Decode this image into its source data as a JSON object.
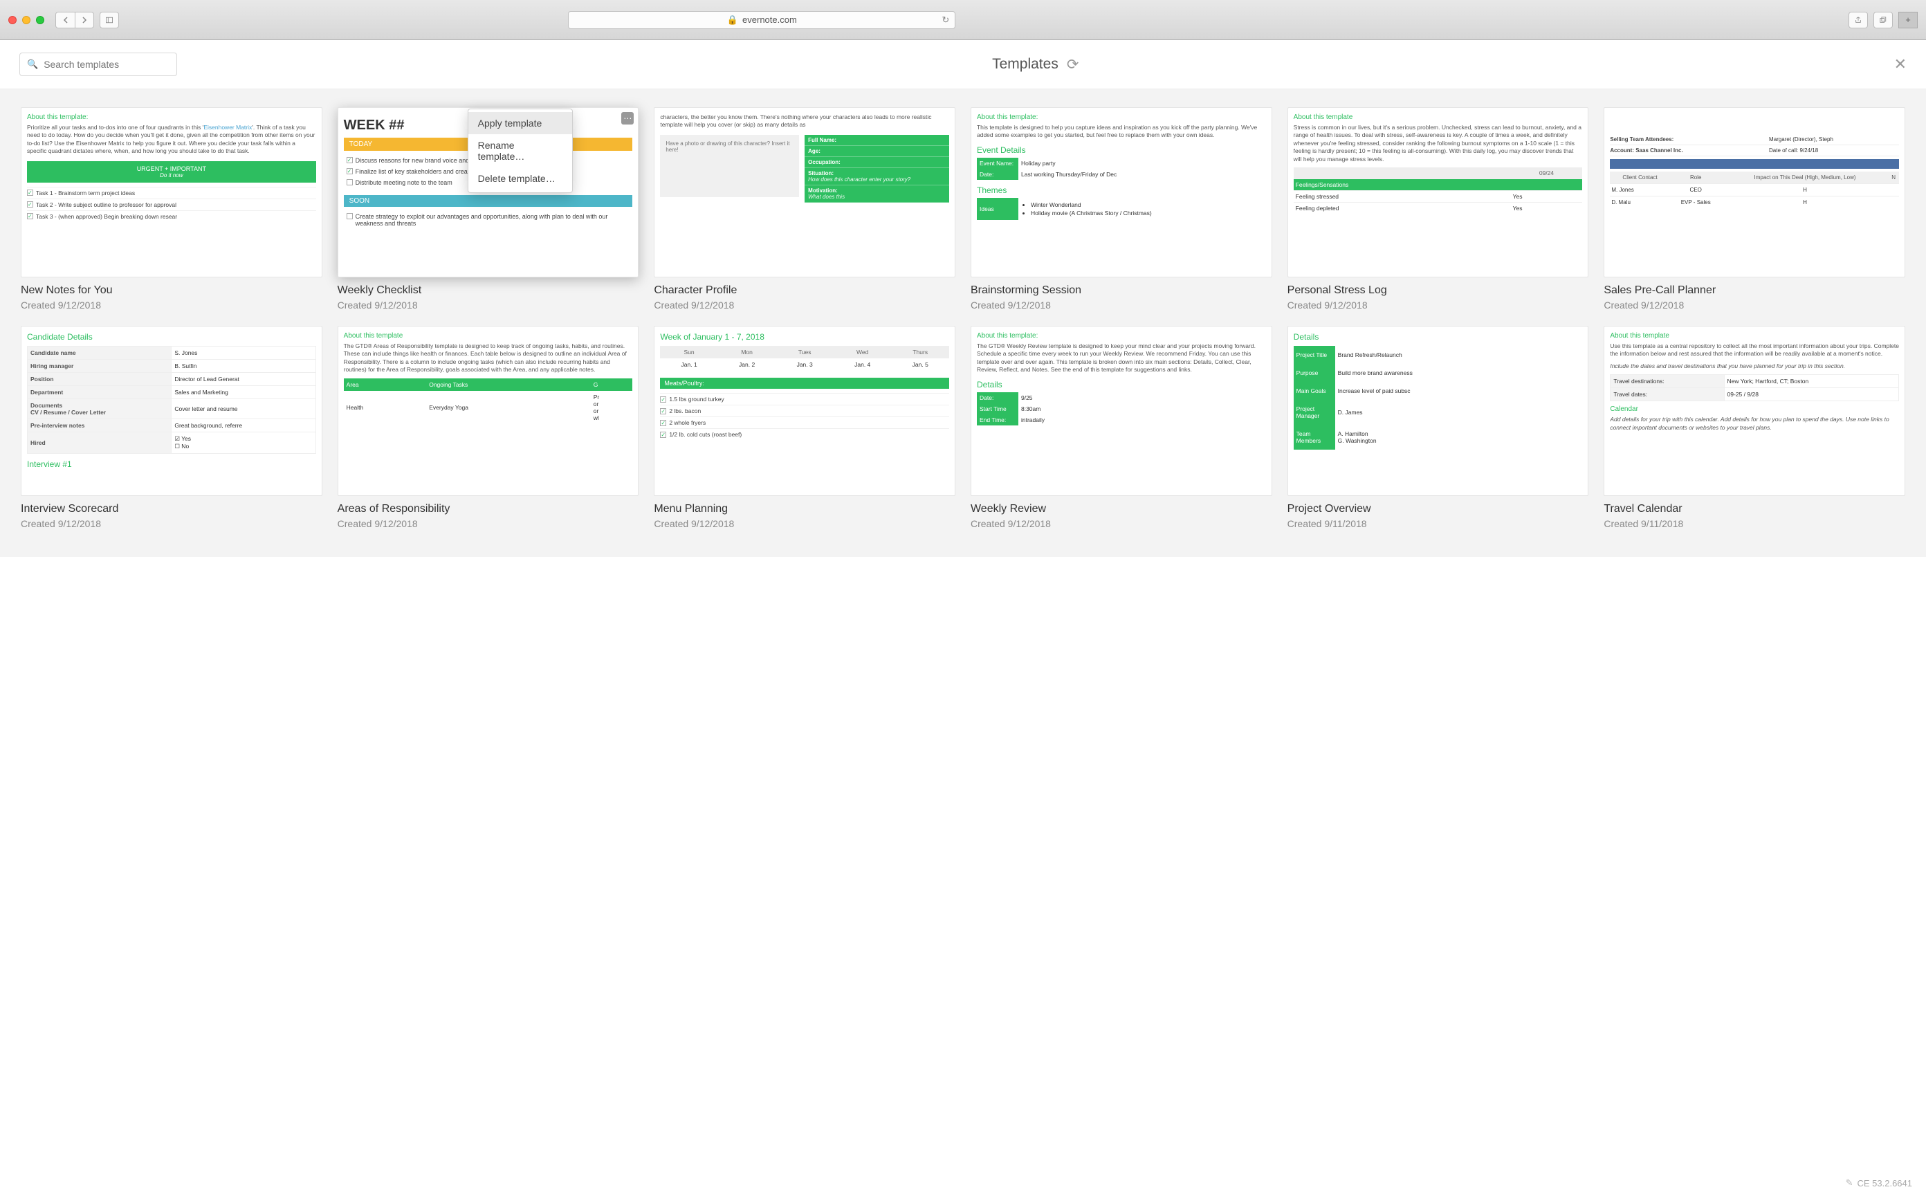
{
  "browser": {
    "url_host": "evernote.com",
    "lock": "🔒"
  },
  "header": {
    "search_placeholder": "Search templates",
    "title": "Templates"
  },
  "dropdown": {
    "apply": "Apply template",
    "rename": "Rename template…",
    "delete": "Delete template…"
  },
  "cards": {
    "new_notes": {
      "title": "New Notes for You",
      "date": "Created 9/12/2018",
      "about_h": "About this template:",
      "about_p": "Prioritize all your tasks and to-dos into one of four quadrants in this 'Eisenhower Matrix'. Think of a task you need to do today. How do you decide when you'll get it done, given all the competition from other items on your to-do list? Use the Eisenhower Matrix to help you figure it out. Where you decide your task falls within a specific quadrant dictates where, when, and how long you should take to do that task.",
      "urgent_h": "URGENT + IMPORTANT",
      "urgent_sub": "Do it now",
      "tasks": [
        "Task 1 - Brainstorm term project ideas",
        "Task 2 - Write subject outline to professor for approval",
        "Task 3 - (when approved) Begin breaking down resear"
      ]
    },
    "weekly_checklist": {
      "title": "Weekly Checklist",
      "date": "Created 9/12/2018",
      "heading": "WEEK ##",
      "today": "TODAY",
      "soon": "SOON",
      "today_items": [
        "Discuss reasons for new brand voice and design for website/app",
        "Finalize list of key stakeholders and creative team",
        "Distribute meeting note to the team"
      ],
      "soon_items": [
        "Create strategy to exploit our advantages and opportunities, along with plan to deal with our weakness and threats"
      ]
    },
    "character": {
      "title": "Character Profile",
      "date": "Created 9/12/2018",
      "intro": "characters, the better you know them. There's nothing where your characters also leads to more realistic template will help you cover (or skip) as many details as",
      "photo": "Have a photo or drawing of this character? Insert it here!",
      "fields": [
        {
          "l": "Full Name:",
          "h": ""
        },
        {
          "l": "Age:",
          "h": ""
        },
        {
          "l": "Occupation:",
          "h": ""
        },
        {
          "l": "Situation:",
          "h": "How does this character enter your story?"
        },
        {
          "l": "Motivation:",
          "h": "What does this"
        }
      ]
    },
    "brainstorm": {
      "title": "Brainstorming Session",
      "date": "Created 9/12/2018",
      "about_h": "About this template:",
      "about_p": "This template is designed to help you capture ideas and inspiration as you kick off the party planning. We've added some examples to get you started, but feel free to replace them with your own ideas.",
      "event_h": "Event Details",
      "event_rows": [
        [
          "Event Name:",
          "Holiday party"
        ],
        [
          "Date:",
          "Last working Thursday/Friday of Dec"
        ]
      ],
      "themes_h": "Themes",
      "ideas_label": "Ideas",
      "ideas": [
        "Winter Wonderland",
        "Holiday movie (A Christmas Story / Christmas)"
      ]
    },
    "stress": {
      "title": "Personal Stress Log",
      "date": "Created 9/12/2018",
      "about_h": "About this template",
      "about_p": "Stress is common in our lives, but it's a serious problem. Unchecked, stress can lead to burnout, anxiety, and a range of health issues. To deal with stress, self-awareness is key. A couple of times a week, and definitely whenever you're feeling stressed, consider ranking the following burnout symptoms on a 1-10 scale (1 = this feeling is hardly present; 10 = this feeling is all-consuming). With this daily log, you may discover trends that will help you manage stress levels.",
      "col_date": "09/24",
      "rows": [
        [
          "Feelings/Sensations",
          ""
        ],
        [
          "Feeling stressed",
          "Yes"
        ],
        [
          "Feeling depleted",
          "Yes"
        ]
      ]
    },
    "sales": {
      "title": "Sales Pre-Call Planner",
      "date": "Created 9/12/2018",
      "rows": [
        [
          "Selling Team Attendees:",
          "Margaret (Director), Steph"
        ],
        [
          "Account: Saas Channel Inc.",
          "Date of call: 9/24/18"
        ]
      ],
      "headers": [
        "Client Contact",
        "Role",
        "Impact on This Deal (High, Medium, Low)",
        "N"
      ],
      "body": [
        [
          "M. Jones",
          "CEO",
          "H",
          ""
        ],
        [
          "D. Malu",
          "EVP - Sales",
          "H",
          ""
        ]
      ]
    },
    "interview": {
      "title": "Interview Scorecard",
      "date": "Created 9/12/2018",
      "h": "Candidate Details",
      "rows": [
        [
          "Candidate name",
          "S. Jones"
        ],
        [
          "Hiring manager",
          "B. Sutfin"
        ],
        [
          "Position",
          "Director of Lead Generat"
        ],
        [
          "Department",
          "Sales and Marketing"
        ],
        [
          "Documents\nCV / Resume / Cover Letter",
          "Cover letter and resume"
        ],
        [
          "Pre-interview notes",
          "Great background, referre"
        ],
        [
          "Hired",
          "☑ Yes\n☐ No"
        ]
      ],
      "footer": "Interview #1"
    },
    "areas": {
      "title": "Areas of Responsibility",
      "date": "Created 9/12/2018",
      "about_h": "About this template",
      "about_p": "The GTD® Areas of Responsibility template is designed to keep track of ongoing tasks, habits, and routines. These can include things like health or finances. Each table below is designed to outline an individual Area of Responsibility. There is a column to include ongoing tasks (which can also include recurring habits and routines) for the Area of Responsibility, goals associated with the Area, and any applicable notes.",
      "headers": [
        "Area",
        "Ongoing Tasks",
        "G"
      ],
      "row": [
        "Health",
        "Everyday Yoga",
        "Pr\nor\nor\nwl"
      ]
    },
    "menu": {
      "title": "Menu Planning",
      "date": "Created 9/12/2018",
      "week": "Week of January 1 - 7, 2018",
      "days": [
        "Sun",
        "Mon",
        "Tues",
        "Wed",
        "Thurs"
      ],
      "dates": [
        "Jan. 1",
        "Jan. 2",
        "Jan. 3",
        "Jan. 4",
        "Jan. 5"
      ],
      "meats_h": "Meats/Poultry:",
      "meats": [
        "1.5 lbs ground turkey",
        "2 lbs. bacon",
        "2 whole fryers",
        "1/2 lb. cold cuts (roast beef)"
      ]
    },
    "weekly_review": {
      "title": "Weekly Review",
      "date": "Created 9/12/2018",
      "about_h": "About this template:",
      "about_p": "The GTD® Weekly Review template is designed to keep your mind clear and your projects moving forward. Schedule a specific time every week to run your Weekly Review. We recommend Friday. You can use this template over and over again. This template is broken down into six main sections: Details, Collect, Clear, Review, Reflect, and Notes.  See the end of this template for suggestions and links.",
      "details_h": "Details",
      "rows": [
        [
          "Date:",
          "9/25"
        ],
        [
          "Start Time",
          "8:30am"
        ],
        [
          "End Time:",
          "intradaily"
        ]
      ]
    },
    "project": {
      "title": "Project Overview",
      "date": "Created 9/11/2018",
      "h": "Details",
      "rows": [
        [
          "Project Title",
          "Brand Refresh/Relaunch"
        ],
        [
          "Purpose",
          "Build more brand awareness"
        ],
        [
          "Main Goals",
          "Increase level of paid subsc"
        ],
        [
          "Project Manager",
          "D. James"
        ],
        [
          "Team Members",
          "A. Hamilton\nG. Washington"
        ]
      ]
    },
    "travel": {
      "title": "Travel Calendar",
      "date": "Created 9/11/2018",
      "about_h": "About this template",
      "about_p": "Use this template as a central repository to collect all the most important information about your trips. Complete the information below and rest assured that the information will be readily available at a moment's notice.",
      "hint": "Include the dates and travel destinations that you have planned for your trip in this section.",
      "rows": [
        [
          "Travel destinations:",
          "New York; Hartford, CT; Boston"
        ],
        [
          "Travel dates:",
          "09-25 / 9/28"
        ]
      ],
      "cal_h": "Calendar",
      "cal_p": "Add details for your trip with this calendar. Add details for how you plan to spend the days. Use note links to connect important documents or websites to your travel plans."
    }
  },
  "footer": {
    "version": "CE 53.2.6641"
  }
}
